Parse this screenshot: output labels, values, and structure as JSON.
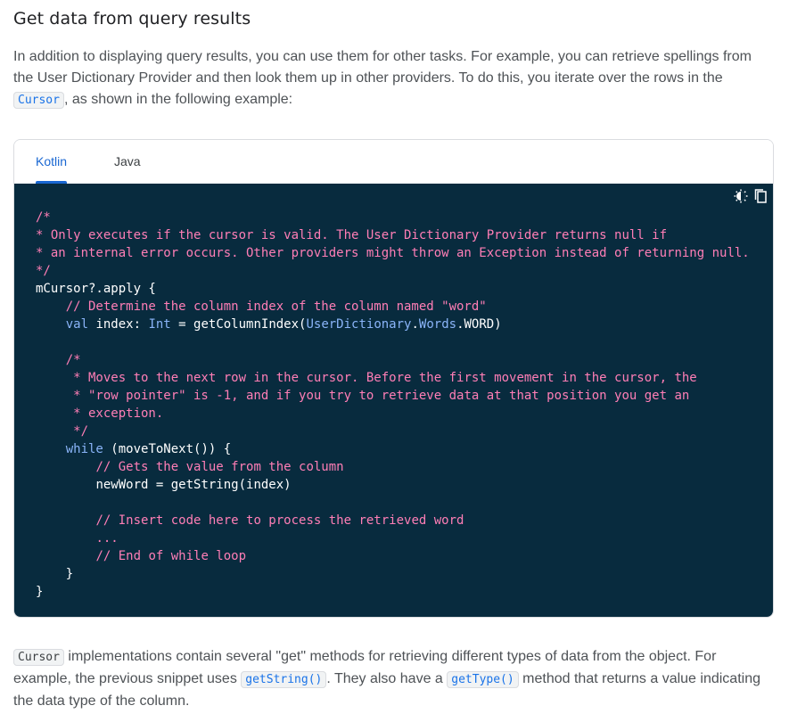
{
  "heading": "Get data from query results",
  "intro": {
    "text_before": "In addition to displaying query results, you can use them for other tasks. For example, you can retrieve spellings from the User Dictionary Provider and then look them up in other providers. To do this, you iterate over the rows in the ",
    "code_cursor": "Cursor",
    "text_after": ", as shown in the following example:"
  },
  "tabs": [
    {
      "label": "Kotlin",
      "active": true
    },
    {
      "label": "Java",
      "active": false
    }
  ],
  "code_tools": {
    "theme_icon": "dark-mode-toggle-icon",
    "copy_icon": "copy-icon"
  },
  "code": {
    "l1": "/*",
    "l2": "* Only executes if the cursor is valid. The User Dictionary Provider returns null if",
    "l3": "* an internal error occurs. Other providers might throw an Exception instead of returning null.",
    "l4": "*/",
    "l5": "mCursor?.apply {",
    "l6": "    // Determine the column index of the column named \"word\"",
    "l7_kw": "val",
    "l7_a": " index: ",
    "l7_type": "Int",
    "l7_b": " = getColumnIndex(",
    "l7_cls1": "UserDictionary",
    "l7_dot": ".",
    "l7_cls2": "Words",
    "l7_c": ".WORD)",
    "l9": "/*",
    "l10": " * Moves to the next row in the cursor. Before the first movement in the cursor, the",
    "l11": " * \"row pointer\" is -1, and if you try to retrieve data at that position you get an",
    "l12": " * exception.",
    "l13": " */",
    "l14_kw": "while",
    "l14_rest": " (moveToNext()) {",
    "l15": "// Gets the value from the column",
    "l16": "newWord = getString(index)",
    "l18": "// Insert code here to process the retrieved word",
    "l19": "...",
    "l20": "// End of while loop",
    "l21": "    }",
    "l22": "}"
  },
  "outro": {
    "code_cursor": "Cursor",
    "text1": " implementations contain several \"get\" methods for retrieving different types of data from the object. For example, the previous snippet uses ",
    "code_getstring": "getString()",
    "text2": ". They also have a ",
    "code_gettype": "getType()",
    "text3": " method that returns a value indicating the data type of the column."
  },
  "colors": {
    "comment": "#ff7eb6",
    "keyword": "#8ab4f8",
    "code_bg": "#082b3e",
    "accent": "#1967d2"
  }
}
